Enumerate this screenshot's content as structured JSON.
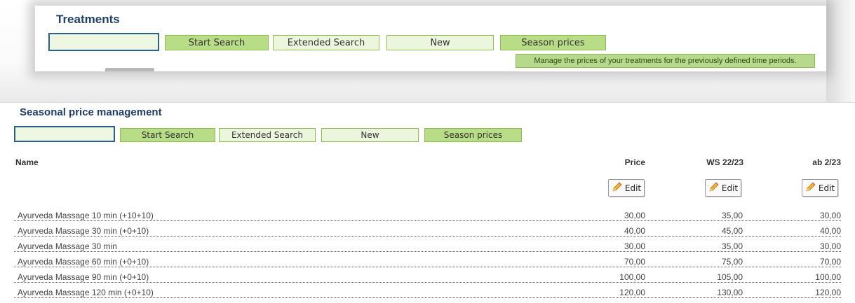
{
  "top_panel": {
    "title": "Treatments",
    "search": {
      "value": "",
      "placeholder": ""
    },
    "buttons": {
      "start_search": "Start Search",
      "extended_search": "Extended Search",
      "new": "New",
      "season_prices": "Season prices"
    },
    "tooltip": "Manage the prices of your treatments for the previously defined time periods."
  },
  "bottom_panel": {
    "title": "Seasonal price management",
    "search": {
      "value": "",
      "placeholder": ""
    },
    "buttons": {
      "start_search": "Start Search",
      "extended_search": "Extended Search",
      "new": "New",
      "season_prices": "Season prices"
    },
    "table": {
      "columns": [
        "Name",
        "Price",
        "WS 22/23",
        "ab 2/23"
      ],
      "edit_label": "Edit",
      "edit_icon": "pencil-icon",
      "rows": [
        {
          "name": "Ayurveda Massage 10 min (+10+10)",
          "price": "30,00",
          "ws": "35,00",
          "ab": "30,00"
        },
        {
          "name": "Ayurveda Massage 30 min (+0+10)",
          "price": "40,00",
          "ws": "45,00",
          "ab": "40,00"
        },
        {
          "name": "Ayurveda Massage 30 min",
          "price": "30,00",
          "ws": "35,00",
          "ab": "30,00"
        },
        {
          "name": "Ayurveda Massage 60 min (+0+10)",
          "price": "70,00",
          "ws": "75,00",
          "ab": "70,00"
        },
        {
          "name": "Ayurveda Massage 90 min (+0+10)",
          "price": "100,00",
          "ws": "105,00",
          "ab": "100,00"
        },
        {
          "name": "Ayurveda Massage 120 min (+0+10)",
          "price": "120,00",
          "ws": "130,00",
          "ab": "120,00"
        }
      ]
    }
  },
  "colors": {
    "title": "#1f3f66",
    "button_dark": "#b9dc86",
    "button_light": "#ecf6dd",
    "search_border": "#2d5f8d",
    "tooltip_bg": "#b7d98c"
  }
}
